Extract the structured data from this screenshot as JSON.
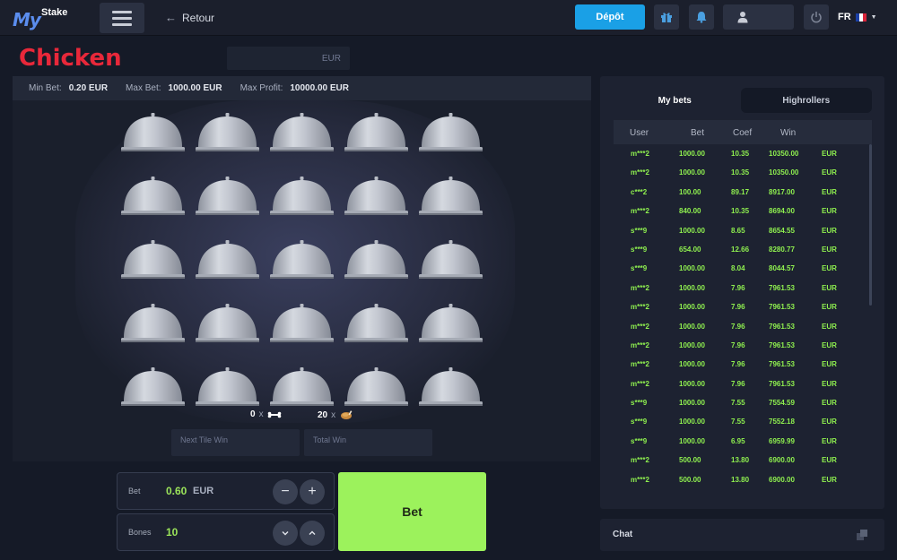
{
  "header": {
    "logo_my": "My",
    "logo_stake": "Stake",
    "back_label": "Retour",
    "deposit_label": "Dépôt",
    "language": "FR",
    "colors": {
      "deposit": "#1aa0e6",
      "bar": "#1b1f2c"
    }
  },
  "game": {
    "title": "Chicken",
    "balance_currency": "EUR",
    "limits": {
      "min_bet_label": "Min Bet:",
      "min_bet_value": "0.20 EUR",
      "max_bet_label": "Max Bet:",
      "max_bet_value": "1000.00 EUR",
      "max_profit_label": "Max Profit:",
      "max_profit_value": "10000.00 EUR"
    },
    "tiles_count": 25,
    "bones_count": "0",
    "chickens_count": "20",
    "times_sign": "x",
    "next_tile_win_placeholder": "Next Tile Win",
    "total_win_placeholder": "Total Win",
    "title_color": "#e8283a"
  },
  "controls": {
    "bet_label": "Bet",
    "bet_value": "0.60",
    "bet_currency": "EUR",
    "minus_icon": "−",
    "plus_icon": "+",
    "bones_label": "Bones",
    "bones_value": "10",
    "bet_button": "Bet",
    "bet_button_color": "#9cf25c"
  },
  "bets_panel": {
    "tabs": [
      "My bets",
      "Highrollers"
    ],
    "columns": [
      "User",
      "Bet",
      "Coef",
      "Win"
    ],
    "rows": [
      [
        "m***2",
        "1000.00",
        "10.35",
        "10350.00",
        "EUR"
      ],
      [
        "m***2",
        "1000.00",
        "10.35",
        "10350.00",
        "EUR"
      ],
      [
        "c***2",
        "100.00",
        "89.17",
        "8917.00",
        "EUR"
      ],
      [
        "m***2",
        "840.00",
        "10.35",
        "8694.00",
        "EUR"
      ],
      [
        "s***9",
        "1000.00",
        "8.65",
        "8654.55",
        "EUR"
      ],
      [
        "s***9",
        "654.00",
        "12.66",
        "8280.77",
        "EUR"
      ],
      [
        "s***9",
        "1000.00",
        "8.04",
        "8044.57",
        "EUR"
      ],
      [
        "m***2",
        "1000.00",
        "7.96",
        "7961.53",
        "EUR"
      ],
      [
        "m***2",
        "1000.00",
        "7.96",
        "7961.53",
        "EUR"
      ],
      [
        "m***2",
        "1000.00",
        "7.96",
        "7961.53",
        "EUR"
      ],
      [
        "m***2",
        "1000.00",
        "7.96",
        "7961.53",
        "EUR"
      ],
      [
        "m***2",
        "1000.00",
        "7.96",
        "7961.53",
        "EUR"
      ],
      [
        "m***2",
        "1000.00",
        "7.96",
        "7961.53",
        "EUR"
      ],
      [
        "s***9",
        "1000.00",
        "7.55",
        "7554.59",
        "EUR"
      ],
      [
        "s***9",
        "1000.00",
        "7.55",
        "7552.18",
        "EUR"
      ],
      [
        "s***9",
        "1000.00",
        "6.95",
        "6959.99",
        "EUR"
      ],
      [
        "m***2",
        "500.00",
        "13.80",
        "6900.00",
        "EUR"
      ],
      [
        "m***2",
        "500.00",
        "13.80",
        "6900.00",
        "EUR"
      ]
    ],
    "win_color": "#8ff04f"
  },
  "chat": {
    "label": "Chat"
  }
}
